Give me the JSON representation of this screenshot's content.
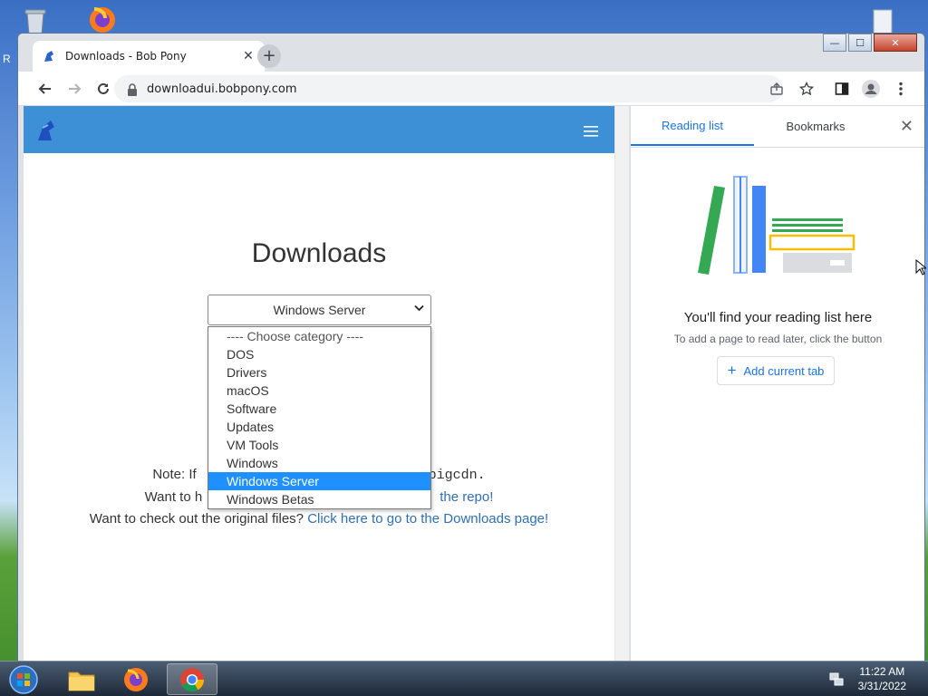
{
  "desktop": {
    "edge_label": "R"
  },
  "browser": {
    "tab": {
      "title": "Downloads - Bob Pony",
      "close_glyph": "✕"
    },
    "new_tab_glyph": "+",
    "window_controls": {
      "minimize": "—",
      "maximize": "☐",
      "close": "✕"
    },
    "url": "downloadui.bobpony.com"
  },
  "page": {
    "title": "Downloads",
    "select_value": "Windows Server",
    "dropdown_options": [
      "---- Choose category ----",
      "DOS",
      "Drivers",
      "macOS",
      "Software",
      "Updates",
      "VM Tools",
      "Windows",
      "Windows Server",
      "Windows Betas"
    ],
    "selected_option": "Windows Server",
    "note_prefix": "Note: If",
    "note_suffix": "pigcdn.",
    "want_prefix": "Want to h",
    "want_link": "the repo!",
    "original_text": "Want to check out the original files?",
    "original_link": "Click here to go to the Downloads page!"
  },
  "side_panel": {
    "tabs": [
      "Reading list",
      "Bookmarks"
    ],
    "active_tab": "Reading list",
    "close_glyph": "✕",
    "heading": "You'll find your reading list here",
    "subtext": "To add a page to read later, click the button",
    "add_button": "Add current tab"
  },
  "taskbar": {
    "time": "11:22 AM",
    "date": "3/31/2022"
  },
  "colors": {
    "site_header": "#3d8fd6",
    "link": "#2f6fb3",
    "selected_option_bg": "#1e90ff",
    "chrome_accent": "#1a73e8"
  }
}
